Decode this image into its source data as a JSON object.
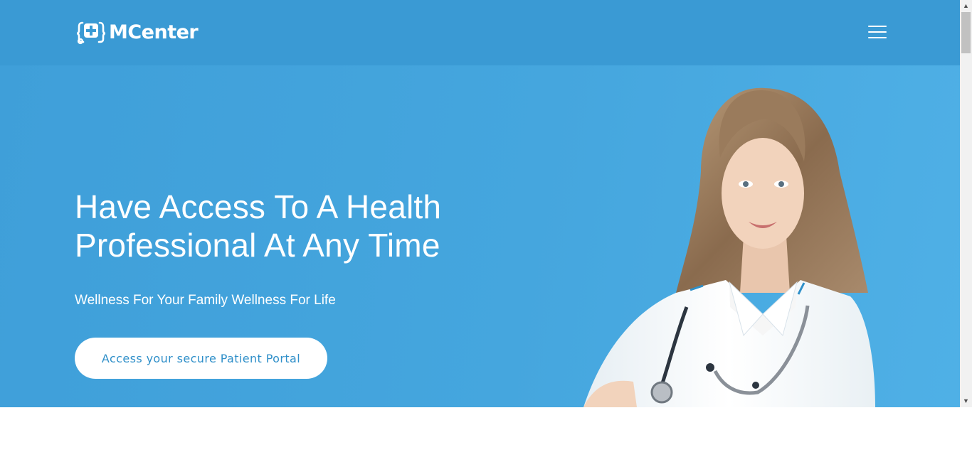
{
  "brand": {
    "name": "MCenter",
    "icon": "stethoscope-plus-icon"
  },
  "nav": {
    "menu_icon": "hamburger-menu-icon"
  },
  "hero": {
    "title_line1": "Have Access To A Health",
    "title_line2": "Professional At Any Time",
    "subtitle": "Wellness For Your Family Wellness For Life",
    "cta_label": "Access your secure Patient Portal"
  },
  "colors": {
    "navbar": "#3a9ad4",
    "hero_background": "#45a6de",
    "button_text": "#2f8fc9",
    "white": "#ffffff"
  },
  "scrollbar": {
    "up_icon": "scroll-up-arrow-icon",
    "down_icon": "scroll-down-arrow-icon"
  }
}
